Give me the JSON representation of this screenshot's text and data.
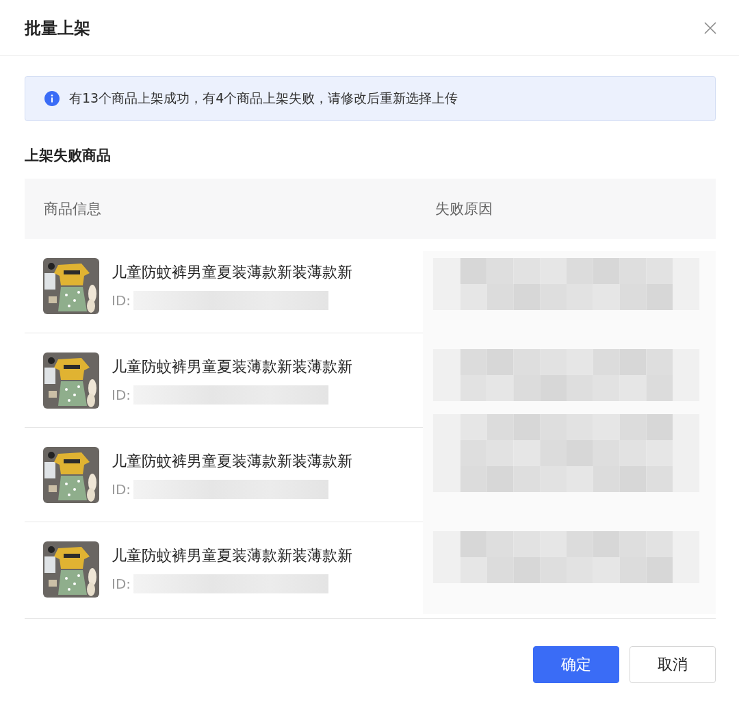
{
  "dialog": {
    "title": "批量上架"
  },
  "alert": {
    "message": "有13个商品上架成功，有4个商品上架失败，请修改后重新选择上传"
  },
  "section_title": "上架失败商品",
  "table": {
    "columns": [
      "商品信息",
      "失败原因"
    ],
    "rows": [
      {
        "name": "儿童防蚊裤男童夏装薄款新装薄款新",
        "id_label": "ID:"
      },
      {
        "name": "儿童防蚊裤男童夏装薄款新装薄款新",
        "id_label": "ID:"
      },
      {
        "name": "儿童防蚊裤男童夏装薄款新装薄款新",
        "id_label": "ID:"
      },
      {
        "name": "儿童防蚊裤男童夏装薄款新装薄款新",
        "id_label": "ID:"
      }
    ]
  },
  "buttons": [
    {
      "label": "确定",
      "kind": "primary"
    },
    {
      "label": "取消",
      "kind": "secondary"
    }
  ]
}
